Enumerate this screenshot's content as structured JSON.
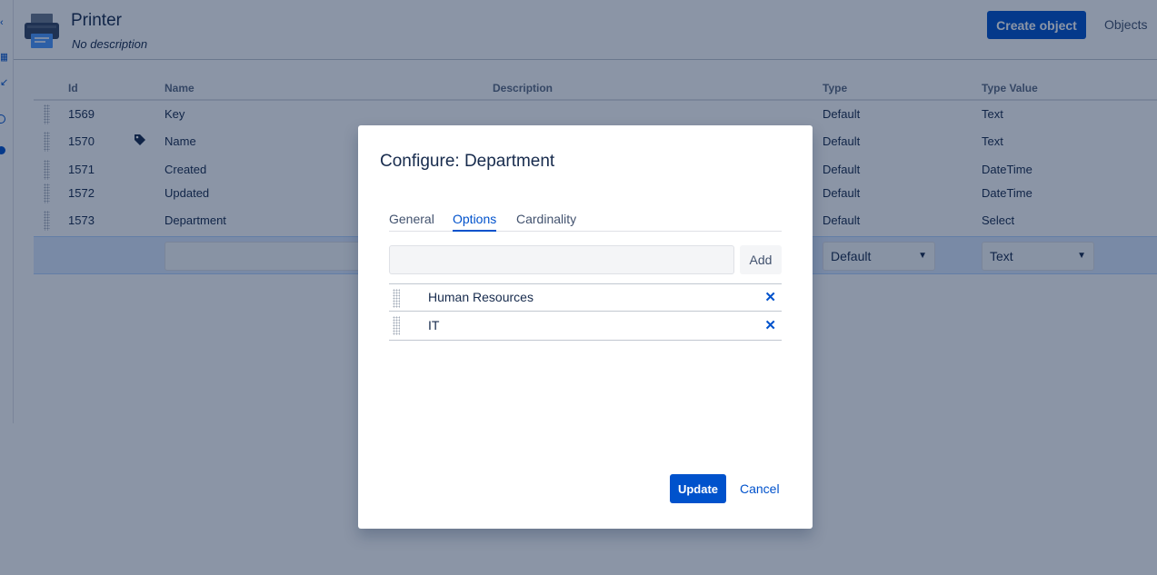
{
  "object_header": {
    "title": "Printer",
    "description": "No description",
    "create_button": "Create object",
    "objects_tab": "Objects"
  },
  "attribute_table": {
    "columns": [
      "Id",
      "Name",
      "Description",
      "Type",
      "Type Value"
    ],
    "rows": [
      {
        "id": "1569",
        "name": "Key",
        "description": "",
        "type": "Default",
        "type_value": "Text",
        "has_label_icon": false
      },
      {
        "id": "1570",
        "name": "Name",
        "description": "",
        "type": "Default",
        "type_value": "Text",
        "has_label_icon": true
      },
      {
        "id": "1571",
        "name": "Created",
        "description": "",
        "type": "Default",
        "type_value": "DateTime",
        "has_label_icon": false
      },
      {
        "id": "1572",
        "name": "Updated",
        "description": "",
        "type": "Default",
        "type_value": "DateTime",
        "has_label_icon": false
      },
      {
        "id": "1573",
        "name": "Department",
        "description": "",
        "type": "Default",
        "type_value": "Select",
        "has_label_icon": false
      }
    ],
    "new_row": {
      "name_value": "",
      "type_select": "Default",
      "type_value_select": "Text"
    }
  },
  "modal": {
    "title": "Configure: Department",
    "tabs": [
      {
        "label": "General",
        "active": false
      },
      {
        "label": "Options",
        "active": true
      },
      {
        "label": "Cardinality",
        "active": false
      }
    ],
    "option_input_value": "",
    "add_button": "Add",
    "options": [
      {
        "label": "Human Resources",
        "remove_icon": "✕"
      },
      {
        "label": "IT",
        "remove_icon": "✕"
      }
    ],
    "update_button": "Update",
    "cancel_link": "Cancel"
  },
  "icons": {
    "printer": "printer-icon",
    "label": "tag-icon",
    "drag": "drag-handle-icon",
    "chevron": "chevron-down-icon",
    "remove": "close-icon"
  },
  "colors": {
    "primary": "#0052cc",
    "overlay": "rgba(9, 30, 66, 0.47)",
    "new_row_bg": "#deebff"
  }
}
